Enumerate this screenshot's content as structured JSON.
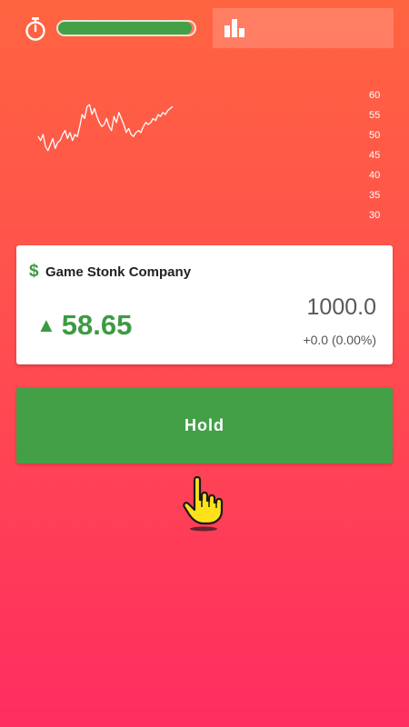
{
  "hud": {
    "timer_icon": "stopwatch-icon",
    "round_progress": 0.98,
    "progress_color": "#43a047",
    "stats_icon": "bar-chart-icon"
  },
  "chart_data": {
    "type": "line",
    "title": "",
    "xlabel": "",
    "ylabel": "",
    "y_ticks": [
      "60",
      "55",
      "50",
      "45",
      "40",
      "35",
      "30"
    ],
    "ylim": [
      30,
      60
    ],
    "line_color": "#ffffff",
    "values": [
      49.5,
      48.5,
      50,
      47,
      46,
      47.5,
      49,
      46.5,
      48,
      48.5,
      50,
      51,
      49,
      50.5,
      48.5,
      50,
      49.5,
      52,
      55,
      54,
      57,
      57.5,
      55,
      56.5,
      54.5,
      53,
      52,
      52.5,
      54,
      52,
      51,
      54.5,
      53,
      55.5,
      54,
      52.5,
      50.5,
      51.5,
      50,
      49.5,
      50.5,
      51,
      50.5,
      52,
      53,
      52.5,
      53,
      54,
      53.5,
      55,
      54.5,
      55.5,
      55,
      56,
      56.5,
      57
    ]
  },
  "card": {
    "currency_icon": "$",
    "company": "Game Stonk Company",
    "trend_icon": "▲",
    "price": "58.65",
    "balance": "1000.0",
    "change": "+0.0 (0.00%)"
  },
  "action": {
    "label": "Hold",
    "color": "#43a047"
  },
  "tutorial": {
    "hand_icon": "pointing-hand-icon"
  }
}
